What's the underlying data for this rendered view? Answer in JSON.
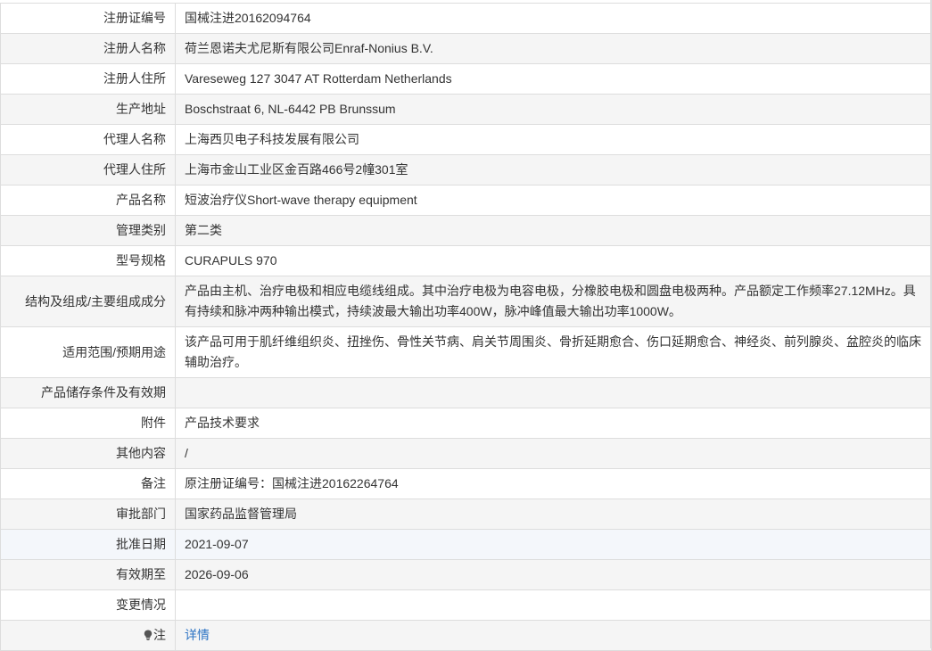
{
  "rows": [
    {
      "label": "注册证编号",
      "value": "国械注进20162094764"
    },
    {
      "label": "注册人名称",
      "value": "荷兰恩诺夫尤尼斯有限公司Enraf-Nonius B.V."
    },
    {
      "label": "注册人住所",
      "value": "Vareseweg 127 3047 AT Rotterdam Netherlands"
    },
    {
      "label": "生产地址",
      "value": "Boschstraat 6, NL-6442 PB Brunssum"
    },
    {
      "label": "代理人名称",
      "value": "上海西贝电子科技发展有限公司"
    },
    {
      "label": "代理人住所",
      "value": "上海市金山工业区金百路466号2幢301室"
    },
    {
      "label": "产品名称",
      "value": "短波治疗仪Short-wave therapy equipment"
    },
    {
      "label": "管理类别",
      "value": "第二类"
    },
    {
      "label": "型号规格",
      "value": "CURAPULS 970"
    },
    {
      "label": "结构及组成/主要组成成分",
      "value": "产品由主机、治疗电极和相应电缆线组成。其中治疗电极为电容电极，分橡胶电极和圆盘电极两种。产品额定工作频率27.12MHz。具有持续和脉冲两种输出模式，持续波最大输出功率400W，脉冲峰值最大输出功率1000W。"
    },
    {
      "label": "适用范围/预期用途",
      "value": "该产品可用于肌纤维组织炎、扭挫伤、骨性关节病、肩关节周围炎、骨折延期愈合、伤口延期愈合、神经炎、前列腺炎、盆腔炎的临床辅助治疗。"
    },
    {
      "label": "产品储存条件及有效期",
      "value": ""
    },
    {
      "label": "附件",
      "value": "产品技术要求"
    },
    {
      "label": "其他内容",
      "value": "/"
    },
    {
      "label": "备注",
      "value": "原注册证编号：国械注进20162264764"
    },
    {
      "label": "审批部门",
      "value": "国家药品监督管理局"
    },
    {
      "label": "批准日期",
      "value": "2021-09-07"
    },
    {
      "label": "有效期至",
      "value": "2026-09-06"
    },
    {
      "label": "变更情况",
      "value": ""
    }
  ],
  "note": {
    "label": "注",
    "icon": "lightbulb-icon",
    "link_text": "详情",
    "link_color": "#2d74c4"
  }
}
